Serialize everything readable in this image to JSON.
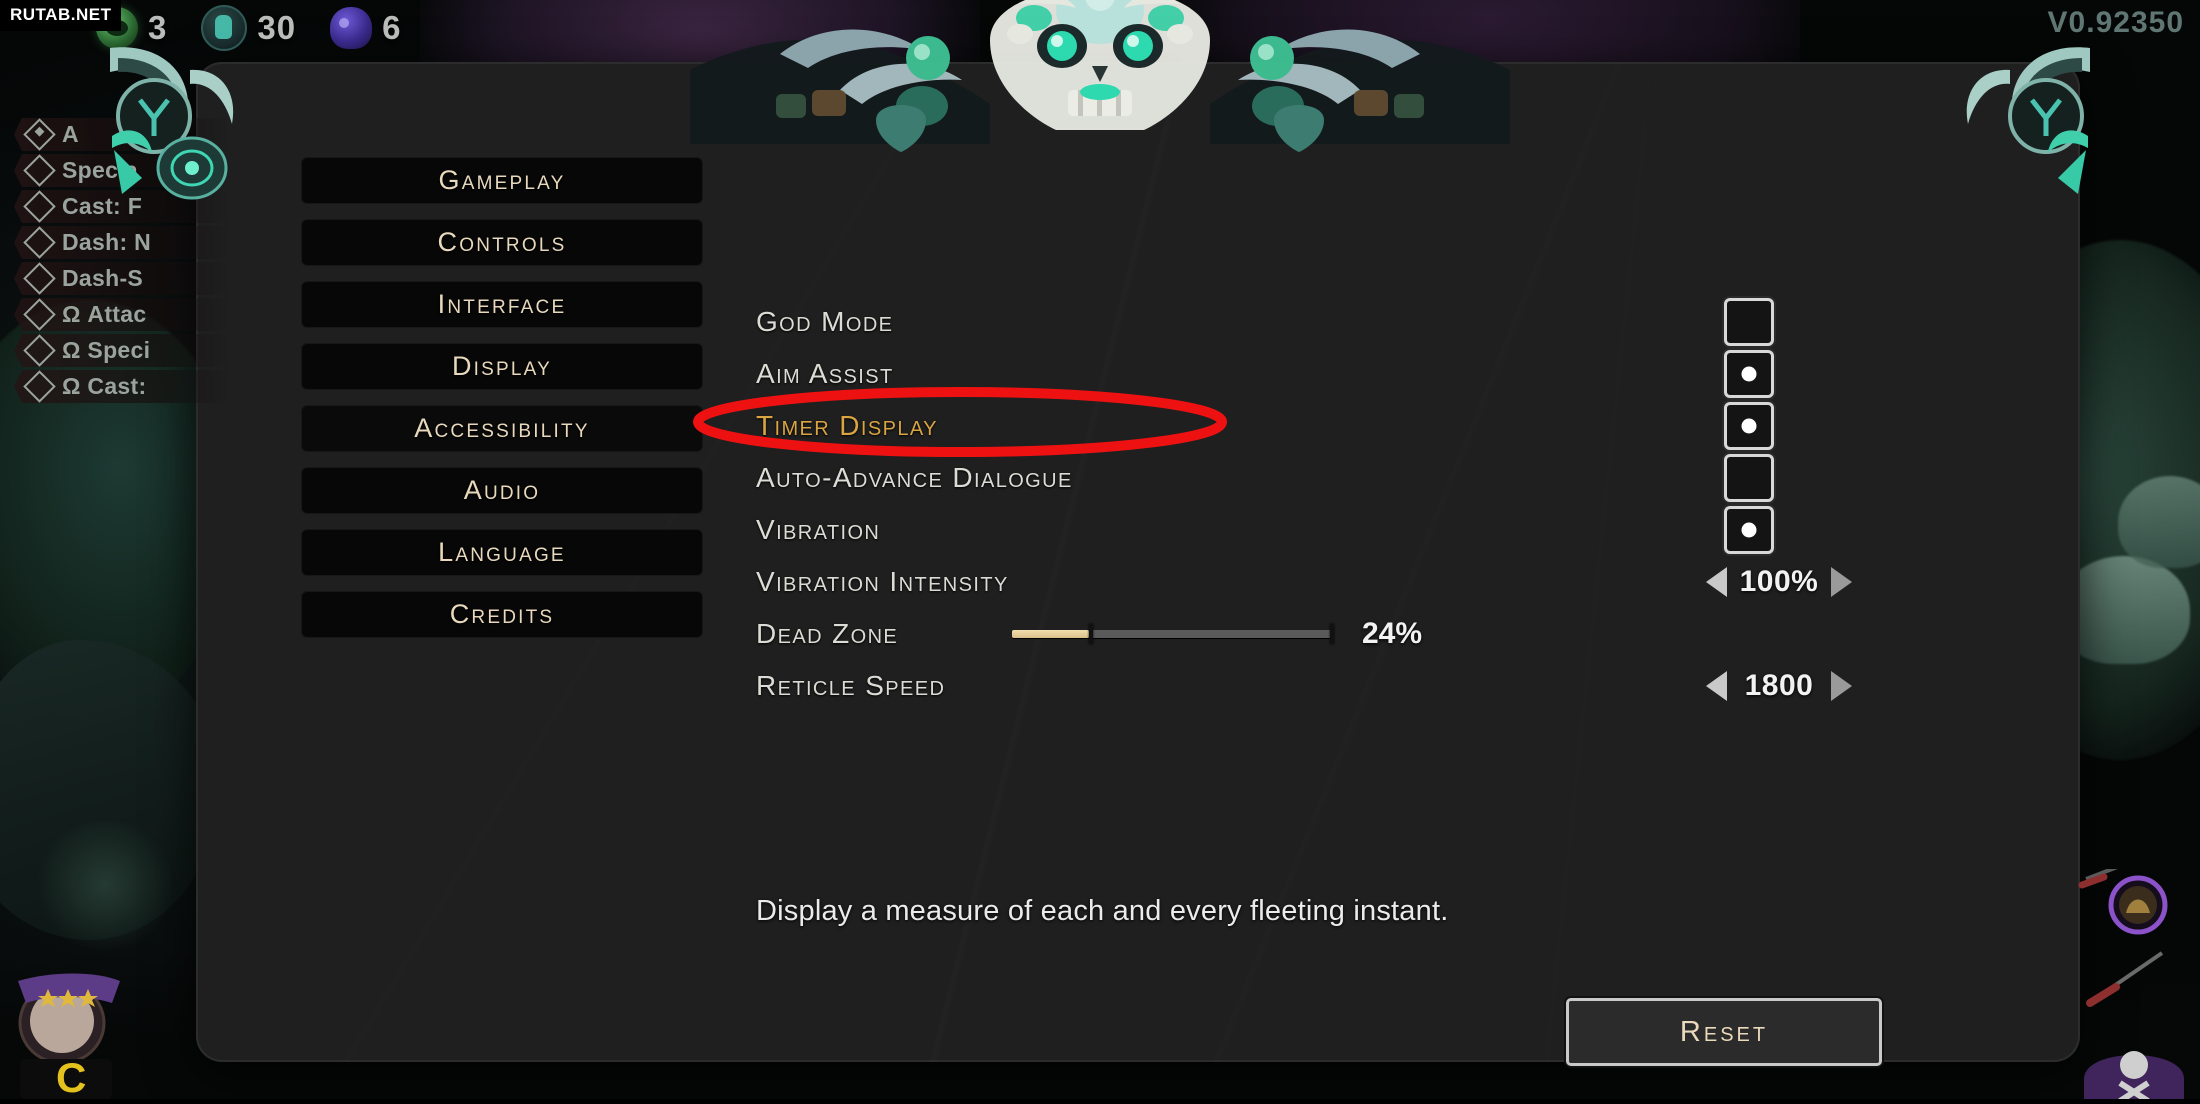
{
  "watermark": "RUTAB.NET",
  "version": "V0.92350",
  "hud": {
    "resources": [
      {
        "icon": "darkness-gem-icon",
        "count": "3"
      },
      {
        "icon": "chthonic-key-icon",
        "count": "30"
      },
      {
        "icon": "gemstone-skull-icon",
        "count": "6"
      }
    ]
  },
  "boons": [
    {
      "label": "A",
      "filled": true
    },
    {
      "label": "Specia",
      "filled": false
    },
    {
      "label": "Cast: F",
      "filled": false
    },
    {
      "label": "Dash: N",
      "filled": false
    },
    {
      "label": "Dash-S",
      "filled": false
    },
    {
      "label": "Ω Attac",
      "filled": false
    },
    {
      "label": "Ω Speci",
      "filled": false
    },
    {
      "label": "Ω Cast:",
      "filled": false
    }
  ],
  "categories": [
    {
      "label": "Gameplay",
      "selected": false
    },
    {
      "label": "Controls",
      "selected": false
    },
    {
      "label": "Interface",
      "selected": false
    },
    {
      "label": "Display",
      "selected": false
    },
    {
      "label": "Accessibility",
      "selected": true
    },
    {
      "label": "Audio",
      "selected": false
    },
    {
      "label": "Language",
      "selected": false
    },
    {
      "label": "Credits",
      "selected": false
    }
  ],
  "settings": [
    {
      "label": "God Mode",
      "type": "checkbox",
      "checked": false,
      "highlighted": false
    },
    {
      "label": "Aim Assist",
      "type": "checkbox",
      "checked": true,
      "highlighted": false
    },
    {
      "label": "Timer Display",
      "type": "checkbox",
      "checked": true,
      "highlighted": true
    },
    {
      "label": "Auto-Advance Dialogue",
      "type": "checkbox",
      "checked": false,
      "highlighted": false
    },
    {
      "label": "Vibration",
      "type": "checkbox",
      "checked": true,
      "highlighted": false
    },
    {
      "label": "Vibration Intensity",
      "type": "stepper",
      "value": "100%",
      "highlighted": false
    },
    {
      "label": "Dead Zone",
      "type": "slider",
      "value": "24%",
      "percent": 24,
      "highlighted": false
    },
    {
      "label": "Reticle Speed",
      "type": "stepper",
      "value": "1800",
      "highlighted": false
    }
  ],
  "description": "Display a measure of each and every fleeting instant.",
  "reset_label": "Reset",
  "annotation": {
    "shape": "red-ellipse",
    "color": "#ee1111"
  },
  "colors": {
    "panel_bg": "#1f1f1f",
    "button_bg": "#070707",
    "menu_text": "#e8d9bd",
    "label_text": "#dcdcd6",
    "highlight_text": "#d9a441",
    "slider_fill": "#e6ce97",
    "annotation_red": "#ee1111"
  }
}
